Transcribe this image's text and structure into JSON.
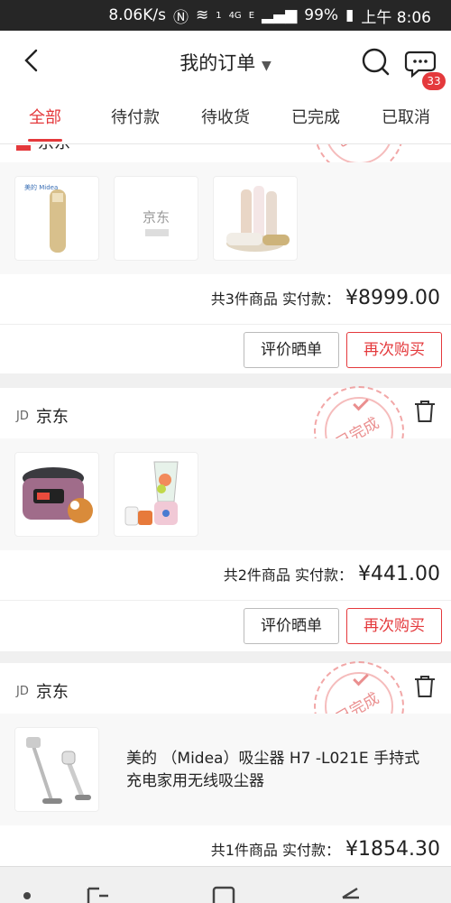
{
  "status_bar": {
    "speed": "8.06K/s",
    "network": "4G",
    "carrier_small": "E",
    "battery": "99%",
    "time": "上午 8:06",
    "sim": "1"
  },
  "header": {
    "title": "我的订单",
    "badge": "33"
  },
  "tabs": [
    "全部",
    "待付款",
    "待收货",
    "已完成",
    "已取消"
  ],
  "orders": [
    {
      "store": "京东",
      "stamp": "已完成",
      "summary": "共3件商品  实付款：",
      "price": "¥8999.00",
      "buttons": [
        "评价晒单",
        "再次购买"
      ],
      "thumb_labels": [
        "京东"
      ]
    },
    {
      "store_prefix": "JD",
      "store": "京东",
      "stamp": "已完成",
      "summary": "共2件商品  实付款：",
      "price": "¥441.00",
      "buttons": [
        "评价晒单",
        "再次购买"
      ]
    },
    {
      "store_prefix": "JD",
      "store": "京东",
      "stamp": "已完成",
      "product_title": "美的 （Midea）吸尘器 H7 -L021E 手持式充电家用无线吸尘器",
      "summary": "共1件商品  实付款：",
      "price": "¥1854.30"
    }
  ],
  "colors": {
    "accent": "#e4393c"
  }
}
